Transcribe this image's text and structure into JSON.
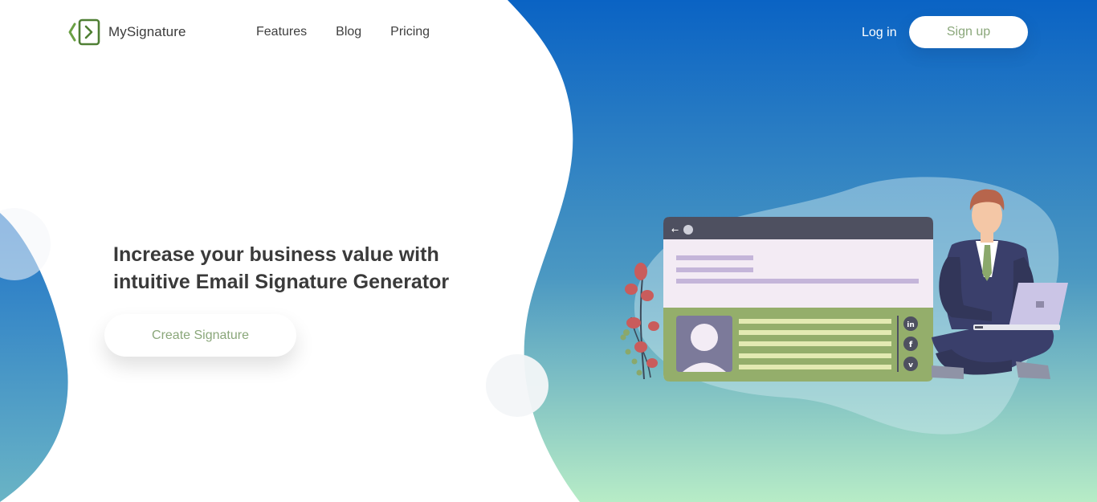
{
  "brand": {
    "name": "MySignature",
    "logo_icon": "code-bracket-logo-icon",
    "accent_color": "#5e8f3a"
  },
  "nav": {
    "items": [
      {
        "label": "Features"
      },
      {
        "label": "Blog"
      },
      {
        "label": "Pricing"
      }
    ]
  },
  "auth": {
    "login_label": "Log in",
    "signup_label": "Sign up"
  },
  "hero": {
    "headline_line1": "Increase your business value with",
    "headline_line2": "intuitive Email Signature Generator",
    "cta_label": "Create Signature"
  },
  "illustration": {
    "name": "email-signature-card-illustration",
    "social_icons": [
      {
        "text": "in",
        "icon": "linkedin-icon"
      },
      {
        "text": "f",
        "icon": "facebook-icon"
      },
      {
        "text": "v",
        "icon": "vimeo-icon"
      }
    ]
  },
  "colors": {
    "gradient_top": "#0a63c4",
    "gradient_bottom": "#b7ecc6",
    "button_text": "#8aa77a"
  }
}
